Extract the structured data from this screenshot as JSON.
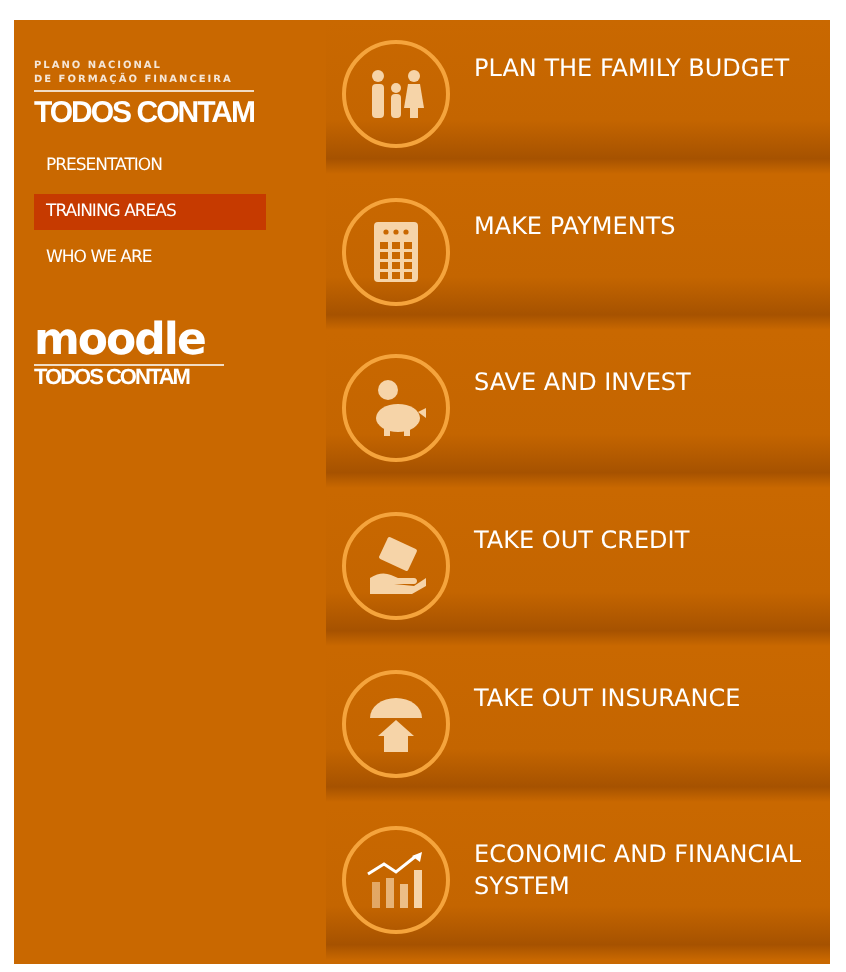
{
  "sidebar": {
    "tagline": [
      "PLANO NACIONAL",
      "DE FORMAÇÃO FINANCEIRA"
    ],
    "brand": "TODOS CONTAM",
    "nav": [
      {
        "label": "PRESENTATION",
        "selected": false
      },
      {
        "label": "TRAINING AREAS",
        "selected": true
      },
      {
        "label": "WHO WE ARE",
        "selected": false
      }
    ],
    "moodle": {
      "name": "moodle",
      "subtitle": "TODOS CONTAM"
    }
  },
  "areas": [
    {
      "kind": "family",
      "title": "PLAN THE FAMILY BUDGET"
    },
    {
      "kind": "calculator",
      "title": "MAKE PAYMENTS"
    },
    {
      "kind": "piggy",
      "title": "SAVE AND INVEST"
    },
    {
      "kind": "credit",
      "title": "TAKE OUT CREDIT"
    },
    {
      "kind": "insurance",
      "title": "TAKE OUT INSURANCE"
    },
    {
      "kind": "chart",
      "title": "ECONOMIC AND FINANCIAL SYSTEM"
    }
  ]
}
